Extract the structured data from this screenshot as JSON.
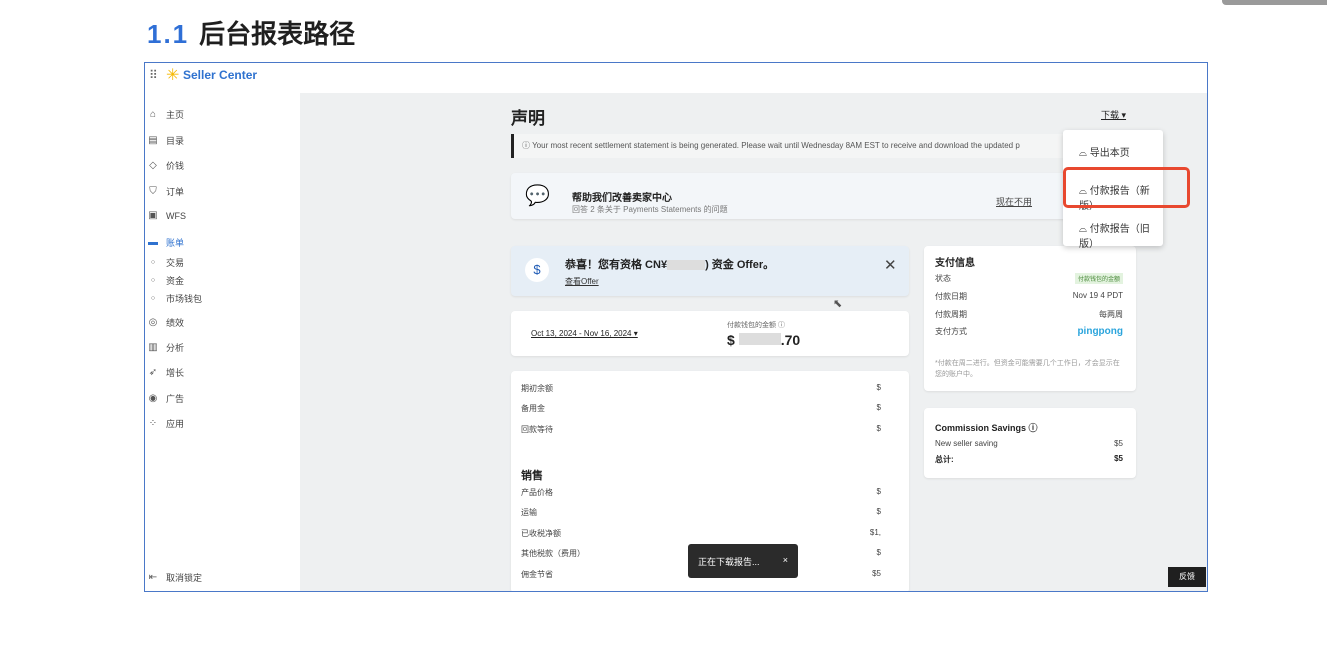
{
  "heading": {
    "number": "1.1",
    "title": "后台报表路径"
  },
  "app": {
    "brand": "Seller Center"
  },
  "sidebar": {
    "items": [
      {
        "label": "主页",
        "icon": "home-icon"
      },
      {
        "label": "目录",
        "icon": "catalog-icon"
      },
      {
        "label": "价钱",
        "icon": "tag-icon"
      },
      {
        "label": "订单",
        "icon": "cart-icon"
      },
      {
        "label": "WFS",
        "icon": "calendar-icon"
      },
      {
        "label": "账单",
        "icon": "card-icon",
        "active": true
      },
      {
        "label": "交易",
        "sub": true
      },
      {
        "label": "资金",
        "sub": true
      },
      {
        "label": "市场钱包",
        "sub": true
      },
      {
        "label": "绩效",
        "icon": "gauge-icon"
      },
      {
        "label": "分析",
        "icon": "chart-icon"
      },
      {
        "label": "增长",
        "icon": "rocket-icon"
      },
      {
        "label": "广告",
        "icon": "target-icon"
      },
      {
        "label": "应用",
        "icon": "apps-icon"
      }
    ],
    "unpin": "取消锁定"
  },
  "main": {
    "title": "声明",
    "download": "下载",
    "notice": "Your most recent settlement statement is being generated. Please wait until Wednesday 8AM EST to receive and download the updated p",
    "help": {
      "title": "帮助我们改善卖家中心",
      "subtitle": "回答 2 条关于 Payments Statements 的问题",
      "later": "现在不用"
    },
    "offer": {
      "prefix": "恭喜！您有资格 CN¥",
      "suffix": ") 资金 Offer。",
      "link": "查看Offer"
    },
    "date_range": "Oct 13, 2024 - Nov 16, 2024",
    "amount_label": "付款钱包的金额",
    "amount_prefix": "$",
    "amount_suffix": ".70",
    "rows": [
      {
        "label": "期初余额",
        "value": "$"
      },
      {
        "label": "备用金",
        "value": "$"
      },
      {
        "label": "回款等待",
        "value": "$"
      }
    ],
    "sales_title": "销售",
    "sales_rows": [
      {
        "label": "产品价格",
        "value": "$"
      },
      {
        "label": "运输",
        "value": "$"
      },
      {
        "label": "已收税净额",
        "value": "$1,"
      },
      {
        "label": "其他税款（费用）",
        "value": "$"
      },
      {
        "label": "佣金节省",
        "value": "$5"
      }
    ]
  },
  "payment": {
    "title": "支付信息",
    "rows": [
      {
        "label": "状态",
        "value": "付款钱包的金额"
      },
      {
        "label": "付款日期",
        "value": "Nov 19  4 PDT"
      },
      {
        "label": "付款周期",
        "value": "每两周"
      },
      {
        "label": "支付方式",
        "value": "pingpong"
      }
    ],
    "note": "*付款在周二进行。但资金可能需要几个工作日，才会显示在您的账户中。"
  },
  "commission": {
    "title": "Commission Savings",
    "rows": [
      {
        "label": "New seller saving",
        "value": "$5"
      },
      {
        "label": "总计:",
        "value": "$5"
      }
    ]
  },
  "download_menu": [
    "导出本页",
    "付款报告（新版）",
    "付款报告（旧版）"
  ],
  "toast": {
    "text": "正在下载报告...",
    "close": "×"
  },
  "feedback": "反馈",
  "colors": {
    "accent": "#2f72cf",
    "highlight": "#e8482f"
  }
}
